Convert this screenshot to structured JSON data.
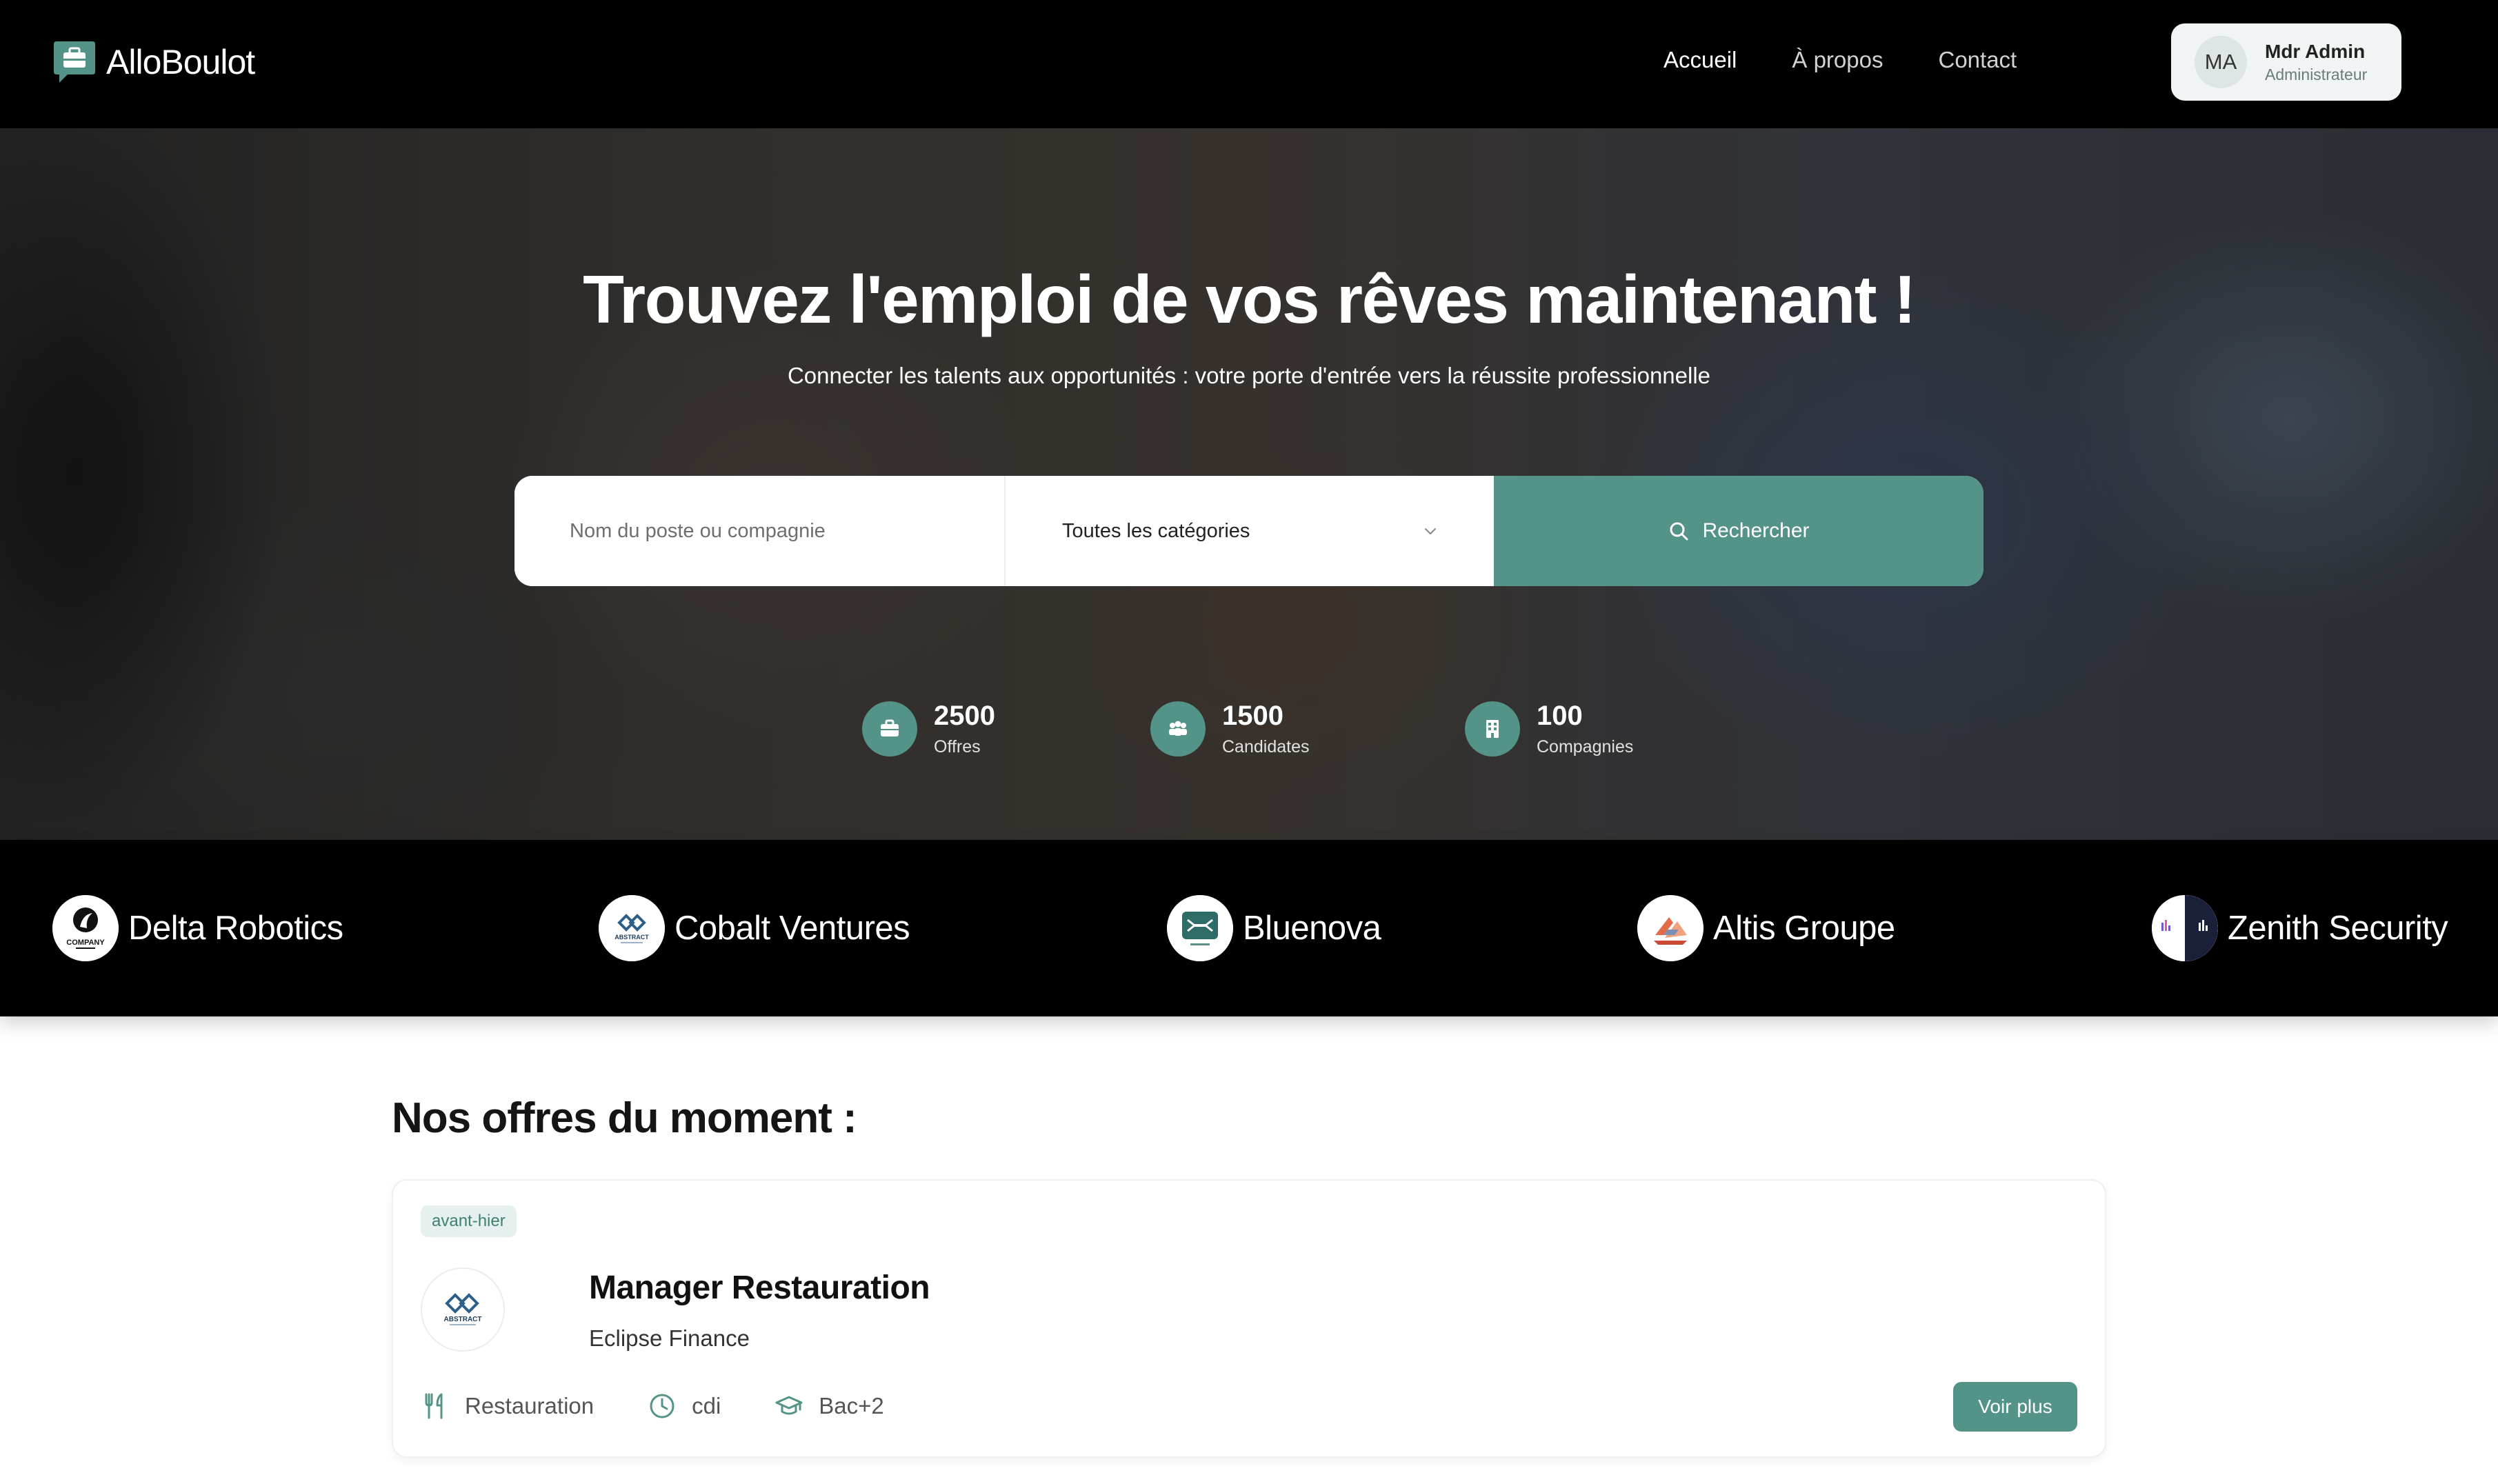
{
  "app": {
    "brand": "AlloBoulot"
  },
  "nav": {
    "links": [
      {
        "label": "Accueil",
        "active": true
      },
      {
        "label": "À propos",
        "active": false
      },
      {
        "label": "Contact",
        "active": false
      }
    ]
  },
  "user": {
    "initials": "MA",
    "name": "Mdr Admin",
    "role": "Administrateur"
  },
  "hero": {
    "title": "Trouvez l'emploi de vos rêves maintenant !",
    "subtitle": "Connecter les talents aux opportunités : votre porte d'entrée vers la réussite professionnelle"
  },
  "search": {
    "placeholder": "Nom du poste ou compagnie",
    "category_selected": "Toutes les catégories",
    "button_label": "Rechercher"
  },
  "stats": [
    {
      "value": "2500",
      "label": "Offres",
      "icon": "briefcase-icon"
    },
    {
      "value": "1500",
      "label": "Candidates",
      "icon": "people-icon"
    },
    {
      "value": "100",
      "label": "Compagnies",
      "icon": "building-icon"
    }
  ],
  "companies": [
    {
      "name": "Delta Robotics",
      "logo": "company-logo"
    },
    {
      "name": "Cobalt Ventures",
      "logo": "abstract-logo"
    },
    {
      "name": "Bluenova",
      "logo": "bluenova-logo"
    },
    {
      "name": "Altis Groupe",
      "logo": "altis-logo"
    },
    {
      "name": "Zenith Security",
      "logo": "zenith-logo"
    }
  ],
  "logo_text": {
    "company": "COMPANY",
    "abstract": "ABSTRACT"
  },
  "offers_section": {
    "title": "Nos offres du moment :"
  },
  "offers": [
    {
      "badge": "avant-hier",
      "title": "Manager Restauration",
      "company": "Eclipse Finance",
      "category": "Restauration",
      "contract": "cdi",
      "education": "Bac+2",
      "button_label": "Voir plus"
    }
  ],
  "colors": {
    "accent": "#549388",
    "navbar_bg": "#000000",
    "badge_bg": "#e6f1ef",
    "badge_text": "#3f7f74"
  }
}
